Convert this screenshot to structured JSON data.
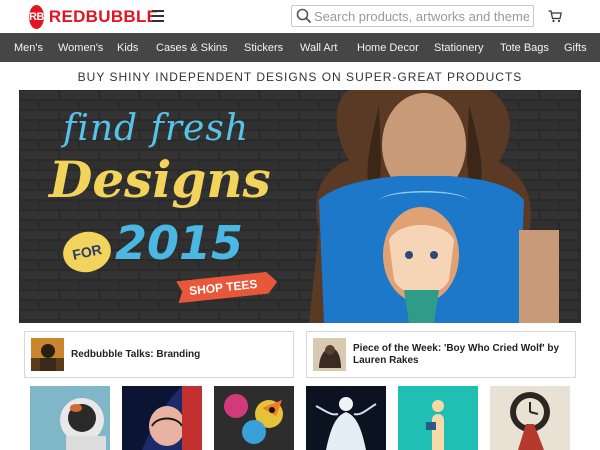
{
  "header": {
    "logo_badge": "RB",
    "logo_text": "REDBUBBLE",
    "search_placeholder": "Search products, artworks and themes"
  },
  "nav": {
    "items": [
      "Men's",
      "Women's",
      "Kids",
      "Cases & Skins",
      "Stickers",
      "Wall Art",
      "Home Decor",
      "Stationery",
      "Tote Bags",
      "Gifts"
    ]
  },
  "tagline": "BUY SHINY INDEPENDENT DESIGNS ON SUPER-GREAT PRODUCTS",
  "hero": {
    "line1": "find fresh",
    "line2": "Designs",
    "for": "FOR",
    "year": "2015",
    "cta": "SHOP TEES"
  },
  "cards": [
    {
      "title": "Redbubble Talks: Branding"
    },
    {
      "title": "Piece of the Week: 'Boy Who Cried Wolf' by Lauren Rakes"
    }
  ],
  "colors": {
    "brand_red": "#e41321",
    "nav_bg": "#464646",
    "hero_blue": "#58c3e8",
    "hero_yellow": "#f2d35c",
    "cta_orange": "#e8573a"
  },
  "icons": [
    "menu-icon",
    "search-icon",
    "cart-icon"
  ]
}
